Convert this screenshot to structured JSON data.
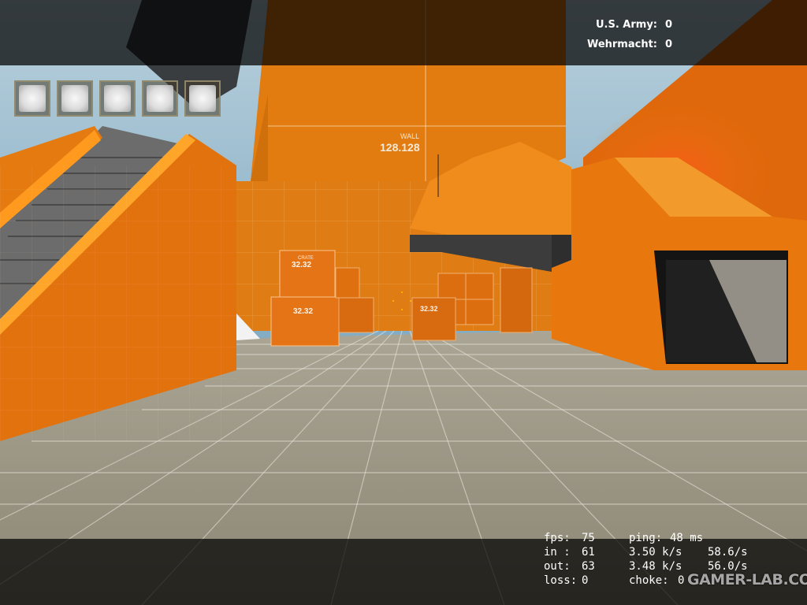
{
  "scoreboard": {
    "teams": [
      {
        "name": "U.S. Army:",
        "score": "0"
      },
      {
        "name": "Wehrmacht:",
        "score": "0"
      }
    ]
  },
  "inventory": {
    "slots": [
      {
        "icon": "empty-slot-icon"
      },
      {
        "icon": "empty-slot-icon"
      },
      {
        "icon": "empty-slot-icon"
      },
      {
        "icon": "empty-slot-icon"
      },
      {
        "icon": "empty-slot-icon"
      }
    ]
  },
  "world_text": {
    "wall_label": "WALL",
    "wall_size": "128.128",
    "crate_label": "CRATE",
    "crate_size": "32.32"
  },
  "netgraph": {
    "fps_label": "fps:",
    "fps": "75",
    "ping_label": "ping:",
    "ping": "48 ms",
    "in_label": "in :",
    "in": "61",
    "in_rate": "3.50 k/s",
    "in_pps": "58.6/s",
    "out_label": "out:",
    "out": "63",
    "out_rate": "3.48 k/s",
    "out_pps": "56.0/s",
    "loss_label": "loss:",
    "loss": "0",
    "choke_label": "choke:",
    "choke": "0"
  },
  "watermark": "GAMER-LAB.COM",
  "colors": {
    "dev_orange": "#e87a14",
    "floor": "#9c9482",
    "sky": "#8fb4c8",
    "hud_overlay": "#000000"
  }
}
